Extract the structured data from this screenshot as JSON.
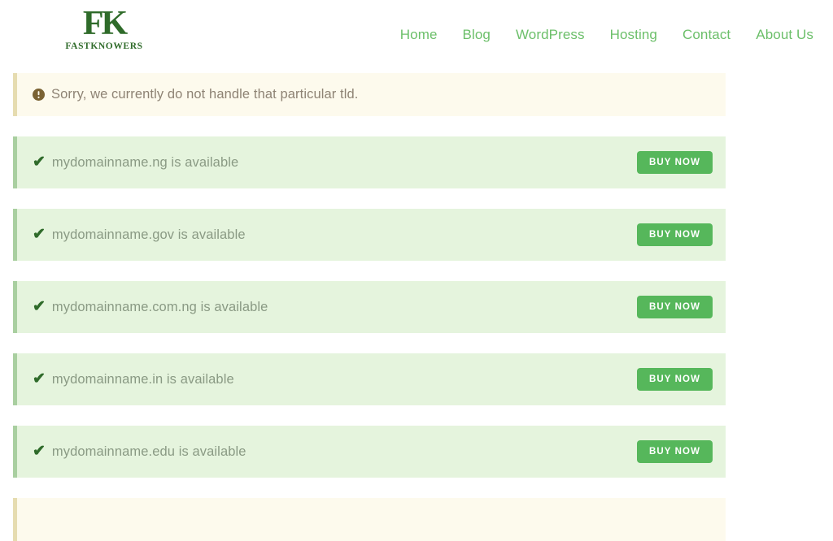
{
  "header": {
    "logo": {
      "mark": "FK",
      "wordmark": "FASTKNOWERS",
      "icon_name": "fastknowers-logo",
      "color": "#2f6b2a"
    },
    "nav": {
      "items": [
        {
          "label": "Home"
        },
        {
          "label": "Blog"
        },
        {
          "label": "WordPress"
        },
        {
          "label": "Hosting"
        },
        {
          "label": "Contact"
        },
        {
          "label": "About Us"
        }
      ],
      "link_color": "#6cbf6a"
    }
  },
  "results": {
    "rows": [
      {
        "type": "alert",
        "icon": "exclamation-circle-icon",
        "icon_glyph": "!",
        "text": "Sorry, we currently do not handle that particular tld.",
        "has_buy_button": false,
        "background": "#fdfaed",
        "border_color": "#e6dcb0",
        "text_color": "#8e8374"
      },
      {
        "type": "success",
        "icon": "check-icon",
        "icon_glyph": "✔",
        "text": "mydomainname.ng is available",
        "has_buy_button": true,
        "buy_label": "BUY NOW",
        "background": "#e5f4dd",
        "border_color": "#a9cfa0",
        "text_color": "#8a9a84"
      },
      {
        "type": "success",
        "icon": "check-icon",
        "icon_glyph": "✔",
        "text": "mydomainname.gov is available",
        "has_buy_button": true,
        "buy_label": "BUY NOW",
        "background": "#e5f4dd",
        "border_color": "#a9cfa0",
        "text_color": "#8a9a84"
      },
      {
        "type": "success",
        "icon": "check-icon",
        "icon_glyph": "✔",
        "text": "mydomainname.com.ng is available",
        "has_buy_button": true,
        "buy_label": "BUY NOW",
        "background": "#e5f4dd",
        "border_color": "#a9cfa0",
        "text_color": "#8a9a84"
      },
      {
        "type": "success",
        "icon": "check-icon",
        "icon_glyph": "✔",
        "text": "mydomainname.in is available",
        "has_buy_button": true,
        "buy_label": "BUY NOW",
        "background": "#e5f4dd",
        "border_color": "#a9cfa0",
        "text_color": "#8a9a84"
      },
      {
        "type": "success",
        "icon": "check-icon",
        "icon_glyph": "✔",
        "text": "mydomainname.edu is available",
        "has_buy_button": true,
        "buy_label": "BUY NOW",
        "background": "#e5f4dd",
        "border_color": "#a9cfa0",
        "text_color": "#8a9a84"
      },
      {
        "type": "alert",
        "icon": "exclamation-circle-icon",
        "icon_glyph": "!",
        "text": "",
        "has_buy_button": false,
        "partial": true,
        "background": "#fdfaed",
        "border_color": "#e6dcb0",
        "text_color": "#8e8374"
      }
    ],
    "buy_button_color": "#56b75b"
  }
}
